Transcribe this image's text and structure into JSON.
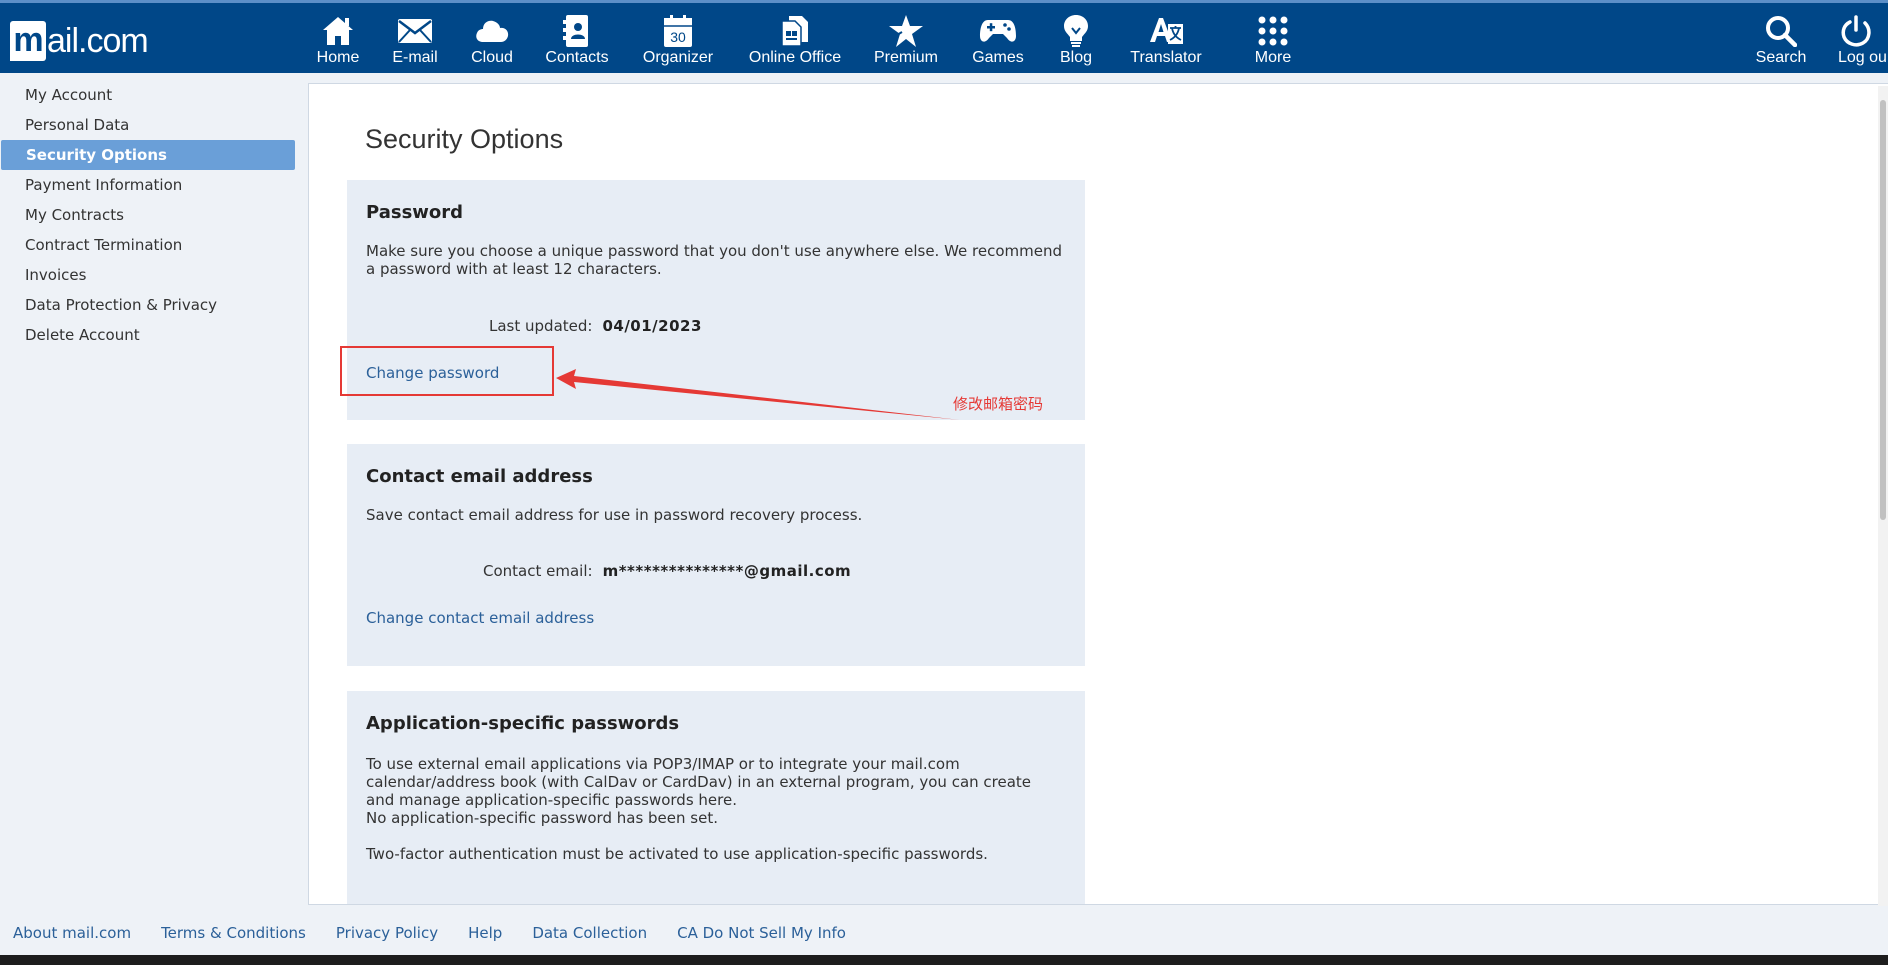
{
  "brand": {
    "logo_text": "mail.com"
  },
  "nav": {
    "items": [
      {
        "label": "Home",
        "icon": "home-icon"
      },
      {
        "label": "E-mail",
        "icon": "envelope-icon"
      },
      {
        "label": "Cloud",
        "icon": "cloud-icon"
      },
      {
        "label": "Contacts",
        "icon": "contacts-icon"
      },
      {
        "label": "Organizer",
        "icon": "calendar-icon",
        "calendar_day": "30"
      },
      {
        "label": "Online Office",
        "icon": "office-document-icon"
      },
      {
        "label": "Premium",
        "icon": "star-icon"
      },
      {
        "label": "Games",
        "icon": "gamepad-icon"
      },
      {
        "label": "Blog",
        "icon": "lightbulb-icon"
      },
      {
        "label": "Translator",
        "icon": "translate-icon"
      },
      {
        "label": "More",
        "icon": "grid-dots-icon"
      }
    ],
    "right": [
      {
        "label": "Search",
        "icon": "search-icon"
      },
      {
        "label": "Log ou",
        "icon": "power-icon"
      }
    ]
  },
  "sidebar": {
    "items": [
      {
        "label": "My Account"
      },
      {
        "label": "Personal Data"
      },
      {
        "label": "Security Options",
        "active": true
      },
      {
        "label": "Payment Information"
      },
      {
        "label": "My Contracts"
      },
      {
        "label": "Contract Termination"
      },
      {
        "label": "Invoices"
      },
      {
        "label": "Data Protection & Privacy"
      },
      {
        "label": "Delete Account"
      }
    ]
  },
  "main": {
    "title": "Security Options",
    "password": {
      "heading": "Password",
      "description": "Make sure you choose a unique password that you don't use anywhere else. We recommend a password with at least 12 characters.",
      "last_updated_label": "Last updated:",
      "last_updated_value": "04/01/2023",
      "change_link": "Change password"
    },
    "contact": {
      "heading": "Contact email address",
      "description": "Save contact email address for use in password recovery process.",
      "email_label": "Contact email:",
      "email_value": "m***************@gmail.com",
      "change_link": "Change contact email address"
    },
    "app_passwords": {
      "heading": "Application-specific passwords",
      "line1": "To use external email applications via POP3/IMAP or to integrate your mail.com",
      "line2": "calendar/address book (with CalDav or CardDav) in an external program, you can create",
      "line3": "and manage application-specific passwords here.",
      "line4": "No application-specific password has been set.",
      "line5": "Two-factor authentication must be activated to use application-specific passwords."
    }
  },
  "annotation": {
    "text": "修改邮箱密码",
    "color": "#e53935"
  },
  "footer": {
    "links": [
      "About mail.com",
      "Terms & Conditions",
      "Privacy Policy",
      "Help",
      "Data Collection",
      "CA Do Not Sell My Info"
    ]
  },
  "colors": {
    "nav_bg": "#004788",
    "active_item": "#6a9fd8",
    "link": "#2b6099",
    "card_bg": "#e7edf5"
  }
}
